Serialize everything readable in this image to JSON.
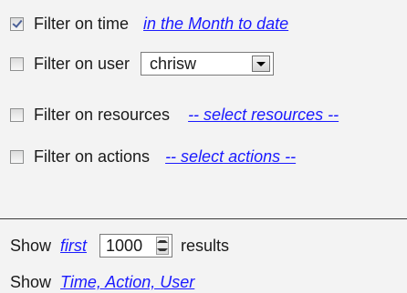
{
  "filters": {
    "time": {
      "checked": true,
      "label": "Filter on time",
      "link": "in the Month to date"
    },
    "user": {
      "checked": false,
      "label": "Filter on user",
      "value": "chrisw"
    },
    "resources": {
      "checked": false,
      "label": "Filter on resources",
      "link": "-- select resources --"
    },
    "actions": {
      "checked": false,
      "label": "Filter on actions",
      "link": "-- select actions --"
    }
  },
  "show_limit": {
    "prefix": "Show",
    "mode_link": "first",
    "count": "1000",
    "suffix": "results"
  },
  "show_columns": {
    "prefix": "Show",
    "columns_link": "Time, Action, User"
  },
  "colors": {
    "link": "#1a1aff",
    "background": "#f3f3f3"
  }
}
